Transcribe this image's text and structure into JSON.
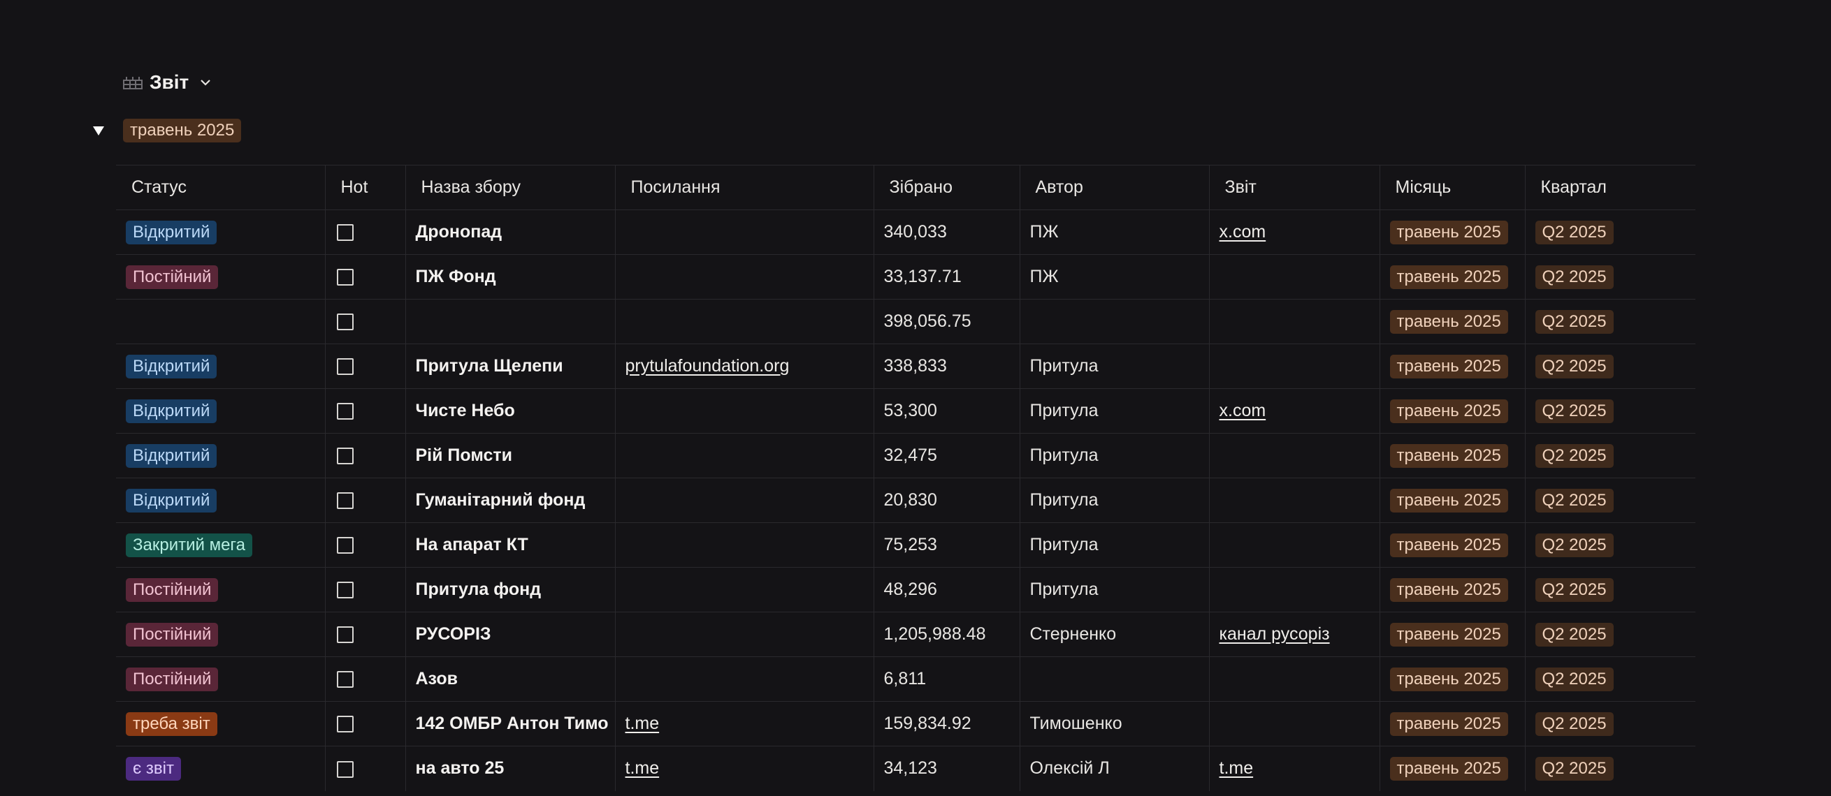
{
  "view": {
    "title": "Звіт",
    "icon": "table-icon"
  },
  "group": {
    "label": "травень 2025"
  },
  "columns": [
    "Статус",
    "Hot",
    "Назва збору",
    "Посилання",
    "Зібрано",
    "Автор",
    "Звіт",
    "Місяць",
    "Квартал"
  ],
  "colors": {
    "background": "#141316",
    "Відкритий": "#183d63",
    "Постійний": "#5a2638",
    "Закритий мега": "#135248",
    "треба звіт": "#8a3a14",
    "є звіт": "#4c2a80",
    "month": "#4a2f1d"
  },
  "rows": [
    {
      "status": "Відкритий",
      "status_kind": "open",
      "hot": false,
      "name": "Дронопад",
      "link": "",
      "collected": "340,033",
      "author": "ПЖ",
      "report": "x.com",
      "month": "травень 2025",
      "quarter": "Q2 2025"
    },
    {
      "status": "Постійний",
      "status_kind": "perm",
      "hot": false,
      "name": "ПЖ Фонд",
      "link": "",
      "collected": "33,137.71",
      "author": "ПЖ",
      "report": "",
      "month": "травень 2025",
      "quarter": "Q2 2025"
    },
    {
      "status": "",
      "status_kind": "",
      "hot": false,
      "name": "",
      "link": "",
      "collected": "398,056.75",
      "author": "",
      "report": "",
      "month": "травень 2025",
      "quarter": "Q2 2025"
    },
    {
      "status": "Відкритий",
      "status_kind": "open",
      "hot": false,
      "name": "Притула Щелепи",
      "link": "prytulafoundation.org",
      "collected": "338,833",
      "author": "Притула",
      "report": "",
      "month": "травень 2025",
      "quarter": "Q2 2025"
    },
    {
      "status": "Відкритий",
      "status_kind": "open",
      "hot": false,
      "name": "Чисте Небо",
      "link": "",
      "collected": "53,300",
      "author": "Притула",
      "report": "x.com",
      "month": "травень 2025",
      "quarter": "Q2 2025"
    },
    {
      "status": "Відкритий",
      "status_kind": "open",
      "hot": false,
      "name": "Рій Помсти",
      "link": "",
      "collected": "32,475",
      "author": "Притула",
      "report": "",
      "month": "травень 2025",
      "quarter": "Q2 2025"
    },
    {
      "status": "Відкритий",
      "status_kind": "open",
      "hot": false,
      "name": "Гуманітарний фонд",
      "link": "",
      "collected": "20,830",
      "author": "Притула",
      "report": "",
      "month": "травень 2025",
      "quarter": "Q2 2025"
    },
    {
      "status": "Закритий мега",
      "status_kind": "closed",
      "hot": false,
      "name": "На апарат КТ",
      "link": "",
      "collected": "75,253",
      "author": "Притула",
      "report": "",
      "month": "травень 2025",
      "quarter": "Q2 2025"
    },
    {
      "status": "Постійний",
      "status_kind": "perm",
      "hot": false,
      "name": "Притула фонд",
      "link": "",
      "collected": "48,296",
      "author": "Притула",
      "report": "",
      "month": "травень 2025",
      "quarter": "Q2 2025"
    },
    {
      "status": "Постійний",
      "status_kind": "perm",
      "hot": false,
      "name": "РУСОРІЗ",
      "link": "",
      "collected": "1,205,988.48",
      "author": "Стерненко",
      "report": "канал русоріз",
      "month": "травень 2025",
      "quarter": "Q2 2025"
    },
    {
      "status": "Постійний",
      "status_kind": "perm",
      "hot": false,
      "name": "Азов",
      "link": "",
      "collected": "6,811",
      "author": "",
      "report": "",
      "month": "травень 2025",
      "quarter": "Q2 2025"
    },
    {
      "status": "треба звіт",
      "status_kind": "needs",
      "hot": false,
      "name": "142 ОМБР Антон Тимо",
      "link": "t.me",
      "collected": "159,834.92",
      "author": "Тимошенко",
      "report": "",
      "month": "травень 2025",
      "quarter": "Q2 2025"
    },
    {
      "status": "є звіт",
      "status_kind": "has",
      "hot": false,
      "name": "на авто 25",
      "link": "t.me",
      "collected": "34,123",
      "author": "Олексій Л",
      "report": "t.me",
      "month": "травень 2025",
      "quarter": "Q2 2025"
    }
  ]
}
